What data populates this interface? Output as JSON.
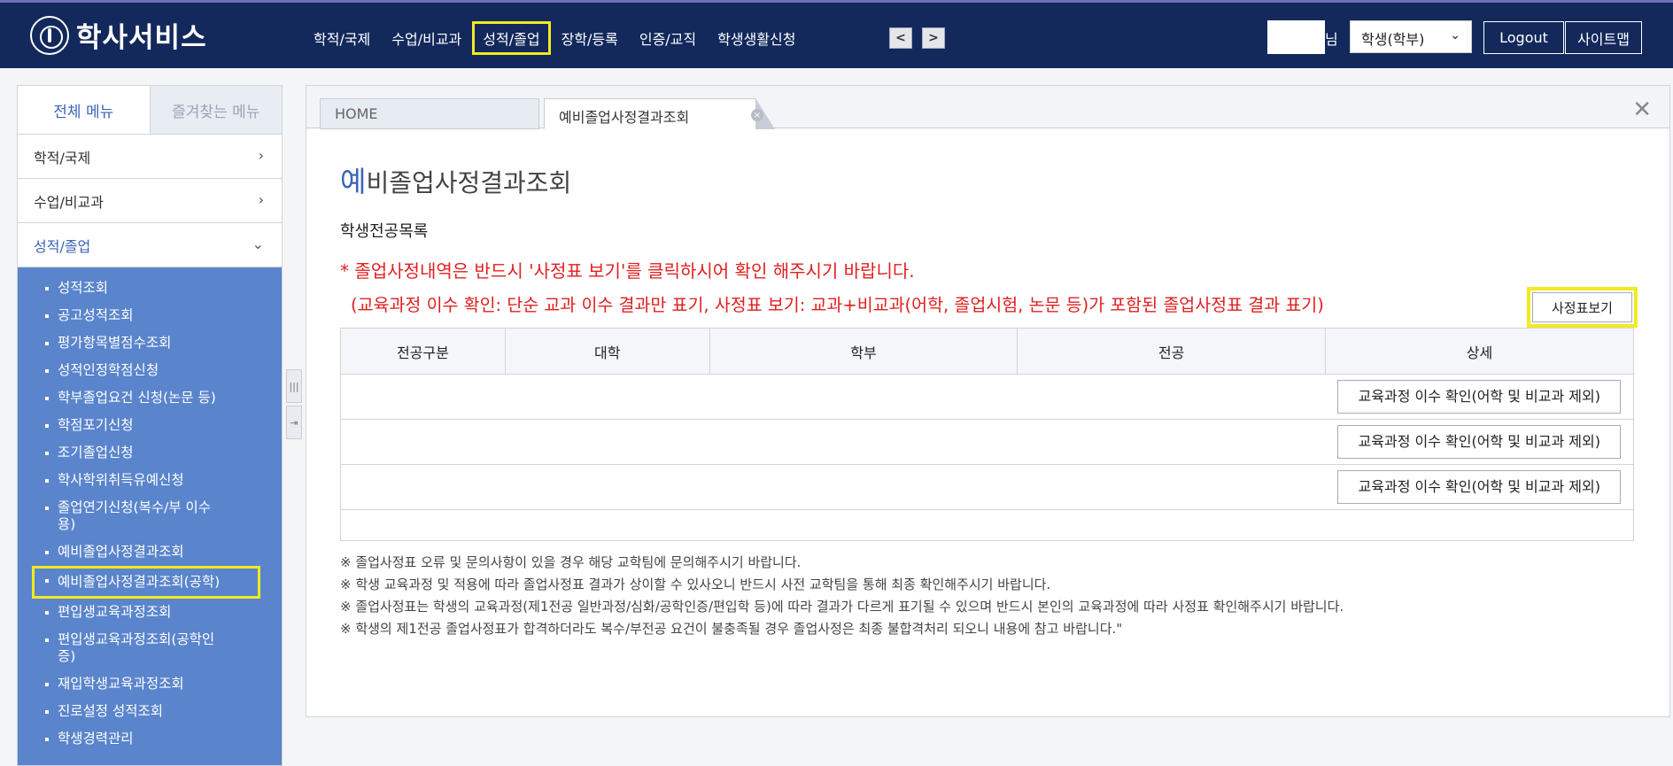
{
  "header": {
    "logo_text": "학사서비스",
    "nav": [
      "학적/국제",
      "수업/비교과",
      "성적/졸업",
      "장학/등록",
      "인증/교직",
      "학생생활신청"
    ],
    "prev_glyph": "<",
    "next_glyph": ">",
    "user_suffix": "님",
    "role": "학생(학부)",
    "logout": "Logout",
    "sitemap": "사이트맵"
  },
  "sidebar": {
    "tab_all": "전체 메뉴",
    "tab_fav": "즐겨찾는 메뉴",
    "categories": [
      "학적/국제",
      "수업/비교과",
      "성적/졸업"
    ],
    "sub_items": [
      "성적조회",
      "공고성적조회",
      "평가항목별점수조회",
      "성적인정학점신청",
      "학부졸업요건 신청(논문 등)",
      "학점포기신청",
      "조기졸업신청",
      "학사학위취득유예신청",
      "졸업연기신청(복수/부 이수 용)",
      "예비졸업사정결과조회",
      "예비졸업사정결과조회(공학)",
      "편입생교육과정조회",
      "편입생교육과정조회(공학인증)",
      "재입학생교육과정조회",
      "진로설정 성적조회",
      "학생경력관리"
    ]
  },
  "main": {
    "tab_home": "HOME",
    "tab_current": "예비졸업사정결과조회",
    "title_first": "예",
    "title_rest": "비졸업사정결과조회",
    "section_title": "학생전공목록",
    "notice1": "* 졸업사정내역은 반드시 '사정표 보기'를 클릭하시어 확인 해주시기 바랍니다.",
    "notice2": "(교육과정 이수 확인: 단순 교과 이수 결과만 표기, 사정표 보기: 교과+비교과(어학, 졸업시험, 논문 등)가 포함된 졸업사정표 결과 표기)",
    "view_button": "사정표보기",
    "columns": [
      "전공구분",
      "대학",
      "학부",
      "전공",
      "상세"
    ],
    "row_button": "교육과정 이수 확인(어학 및 비교과 제외)",
    "notes": [
      "※ 졸업사정표 오류 및 문의사항이 있을 경우 해당 교학팀에 문의해주시기 바랍니다.",
      "※ 학생 교육과정 및 적용에 따라 졸업사정표 결과가 상이할 수 있사오니 반드시 사전 교학팀을 통해 최종 확인해주시기 바랍니다.",
      "※ 졸업사정표는 학생의 교육과정(제1전공 일반과정/심화/공학인증/편입학 등)에 따라 결과가 다르게 표기될 수 있으며 반드시 본인의 교육과정에 따라 사정표 확인해주시기 바랍니다.",
      "※ 학생의 제1전공 졸업사정표가 합격하더라도 복수/부전공 요건이 불충족될 경우 졸업사정은 최종 불합격처리 되오니 내용에 참고 바랍니다.\""
    ]
  },
  "colors": {
    "header_bg": "#13295c",
    "sidebar_sub_bg": "#5a85cc",
    "accent": "#3a64b8",
    "notice": "#e02020",
    "highlight": "#f2ea20"
  }
}
